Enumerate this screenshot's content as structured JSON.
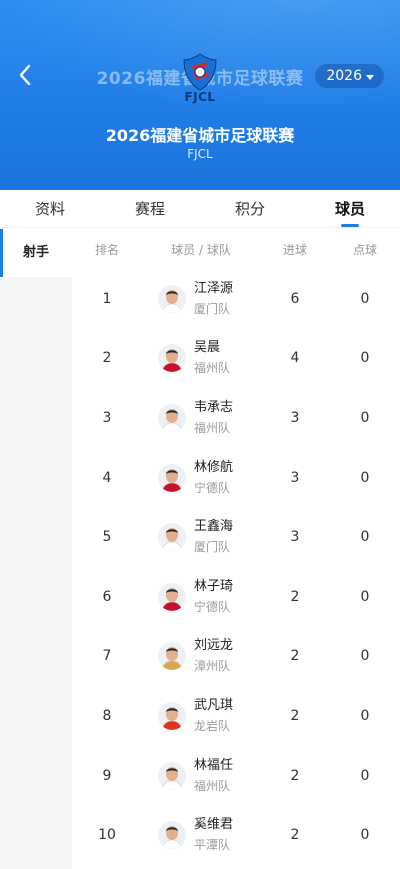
{
  "header": {
    "top_title": "2026福建省城市足球联赛",
    "year": "2026",
    "logo_text": "FJCL",
    "league_name": "2026福建省城市足球联赛",
    "league_sub": "FJCL",
    "colors": {
      "primary": "#1f7de6",
      "logo_red": "#d62b2b",
      "logo_dark": "#0b3a7a"
    }
  },
  "tabs": [
    "资料",
    "赛程",
    "积分",
    "球员"
  ],
  "active_tab": "球员",
  "side_menu": [
    "射手"
  ],
  "table": {
    "headers": {
      "rank": "排名",
      "player": "球员 / 球队",
      "goals": "进球",
      "penalties": "点球"
    },
    "rows": [
      {
        "rank": "1",
        "name": "江泽源",
        "team": "厦门队",
        "goals": "6",
        "penalties": "0",
        "kit": "#ffffff"
      },
      {
        "rank": "2",
        "name": "吴晨",
        "team": "福州队",
        "goals": "4",
        "penalties": "0",
        "kit": "#c8102e"
      },
      {
        "rank": "3",
        "name": "韦承志",
        "team": "福州队",
        "goals": "3",
        "penalties": "0",
        "kit": "#ffffff"
      },
      {
        "rank": "4",
        "name": "林修航",
        "team": "宁德队",
        "goals": "3",
        "penalties": "0",
        "kit": "#c8102e"
      },
      {
        "rank": "5",
        "name": "王鑫海",
        "team": "厦门队",
        "goals": "3",
        "penalties": "0",
        "kit": "#ffffff"
      },
      {
        "rank": "6",
        "name": "林子琦",
        "team": "宁德队",
        "goals": "2",
        "penalties": "0",
        "kit": "#c8102e"
      },
      {
        "rank": "7",
        "name": "刘远龙",
        "team": "漳州队",
        "goals": "2",
        "penalties": "0",
        "kit": "#d9a84e"
      },
      {
        "rank": "8",
        "name": "武凡琪",
        "team": "龙岩队",
        "goals": "2",
        "penalties": "0",
        "kit": "#e0301e"
      },
      {
        "rank": "9",
        "name": "林福任",
        "team": "福州队",
        "goals": "2",
        "penalties": "0",
        "kit": "#ffffff"
      },
      {
        "rank": "10",
        "name": "奚维君",
        "team": "平潭队",
        "goals": "2",
        "penalties": "0",
        "kit": "#ffffff"
      }
    ]
  }
}
